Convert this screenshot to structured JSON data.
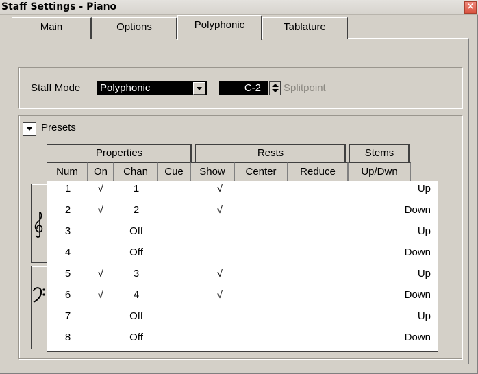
{
  "window": {
    "title": "Staff Settings - Piano",
    "close_glyph": "✕"
  },
  "tabs": [
    {
      "label": "Main"
    },
    {
      "label": "Options"
    },
    {
      "label": "Polyphonic"
    },
    {
      "label": "Tablature"
    }
  ],
  "active_tab": "Polyphonic",
  "staff_mode": {
    "label": "Staff Mode",
    "value": "Polyphonic"
  },
  "splitpoint": {
    "value": "C-2",
    "label": "Splitpoint"
  },
  "presets": {
    "label": "Presets"
  },
  "column_groups": [
    {
      "label": "Properties"
    },
    {
      "label": "Rests"
    },
    {
      "label": "Stems"
    }
  ],
  "columns": [
    "Num",
    "On",
    "Chan",
    "Cue",
    "Show",
    "Center",
    "Reduce",
    "Up/Dwn"
  ],
  "rows": [
    {
      "num": "1",
      "on": "√",
      "chan": "1",
      "cue": "",
      "show": "√",
      "center": "",
      "reduce": "",
      "stem": "Up"
    },
    {
      "num": "2",
      "on": "√",
      "chan": "2",
      "cue": "",
      "show": "√",
      "center": "",
      "reduce": "",
      "stem": "Down"
    },
    {
      "num": "3",
      "on": "",
      "chan": "Off",
      "cue": "",
      "show": "",
      "center": "",
      "reduce": "",
      "stem": "Up"
    },
    {
      "num": "4",
      "on": "",
      "chan": "Off",
      "cue": "",
      "show": "",
      "center": "",
      "reduce": "",
      "stem": "Down"
    },
    {
      "num": "5",
      "on": "√",
      "chan": "3",
      "cue": "",
      "show": "√",
      "center": "",
      "reduce": "",
      "stem": "Up"
    },
    {
      "num": "6",
      "on": "√",
      "chan": "4",
      "cue": "",
      "show": "√",
      "center": "",
      "reduce": "",
      "stem": "Down"
    },
    {
      "num": "7",
      "on": "",
      "chan": "Off",
      "cue": "",
      "show": "",
      "center": "",
      "reduce": "",
      "stem": "Up"
    },
    {
      "num": "8",
      "on": "",
      "chan": "Off",
      "cue": "",
      "show": "",
      "center": "",
      "reduce": "",
      "stem": "Down"
    }
  ],
  "clefs": {
    "treble_icon": "treble-clef",
    "bass_icon": "bass-clef"
  },
  "colors": {
    "dialog_bg": "#d4d0c8",
    "field_bg": "#000000",
    "field_text": "#ffffff"
  }
}
